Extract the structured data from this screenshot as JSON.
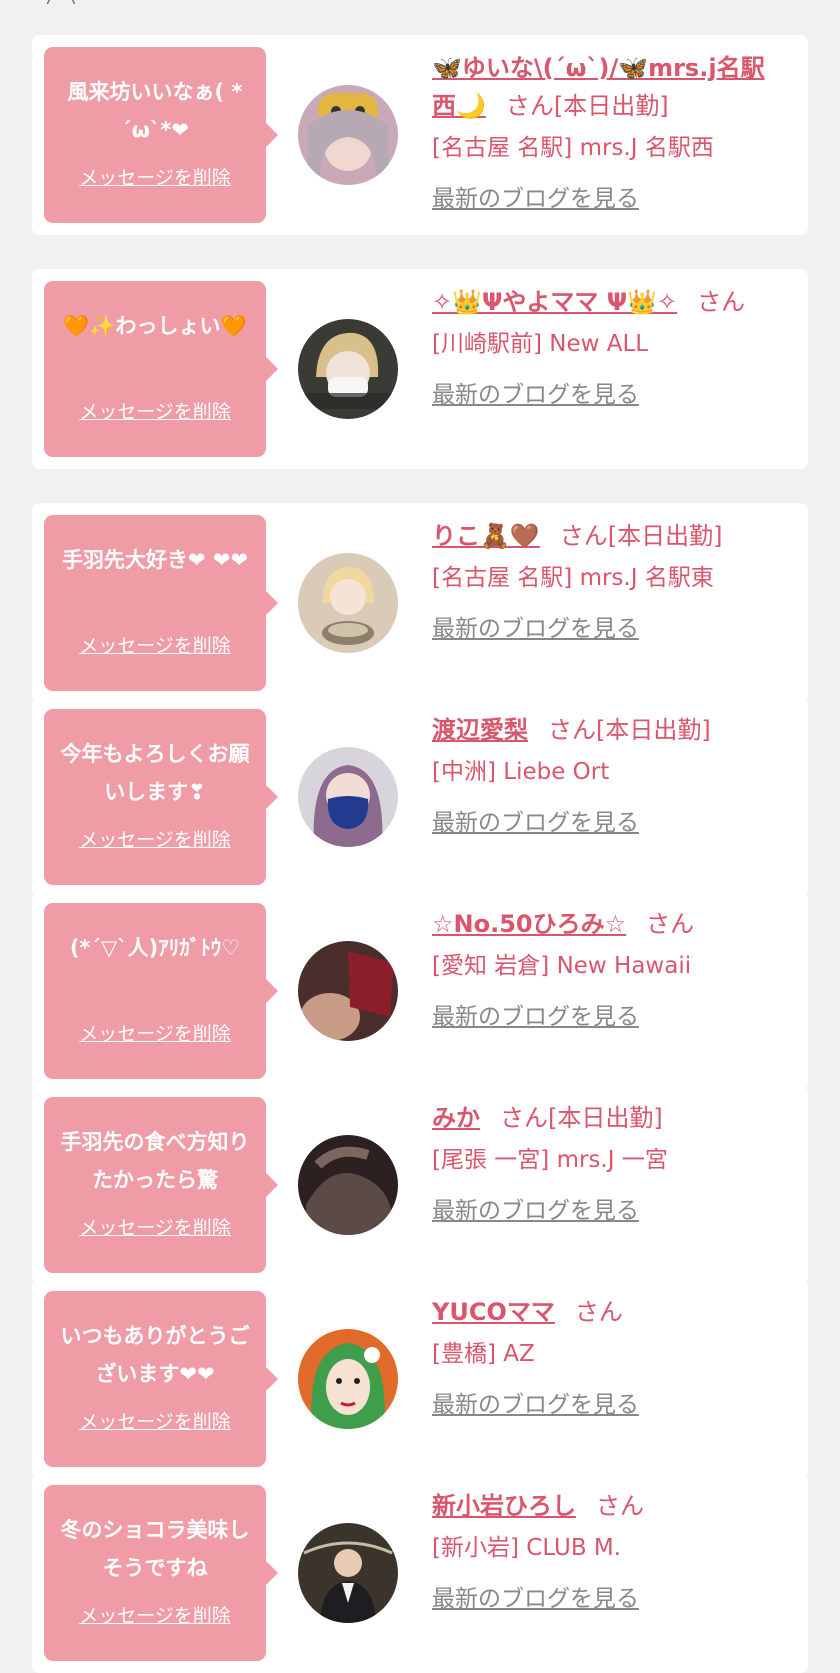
{
  "top_fragment": "（　）",
  "colors": {
    "background": "#f1f1f1",
    "bubble": "#ef9ca6",
    "accent": "#d9566c",
    "muted": "#888888"
  },
  "cards": [
    {
      "message": "風来坊いいなぁ( * ´ω`*❤",
      "delete_label": "メッセージを削除",
      "name": "🦋ゆいな\\(´ω`)/🦋mrs.j名駅西🌙",
      "honorific": "さん[本日出勤]",
      "shop": "[名古屋 名駅] mrs.J 名駅西",
      "blog_label": "最新のブログを見る",
      "avatar_icon": "profile-photo-tiger-filter"
    },
    {
      "message": "🧡✨わっしょい🧡",
      "delete_label": "メッセージを削除",
      "name": "✧👑Ψやよママ Ψ👑✧",
      "honorific": "さん",
      "shop": "[川崎駅前] New ALL",
      "blog_label": "最新のブログを見る",
      "avatar_icon": "profile-photo-mask"
    },
    {
      "message": "手羽先大好き❤ ❤❤",
      "delete_label": "メッセージを削除",
      "name": "りこ🧸🤎",
      "honorific": "さん[本日出勤]",
      "shop": "[名古屋 名駅] mrs.J 名駅東",
      "blog_label": "最新のブログを見る",
      "avatar_icon": "profile-photo-bowl"
    },
    {
      "message": "今年もよろしくお願いします❣",
      "delete_label": "メッセージを削除",
      "name": "渡辺愛梨",
      "honorific": "さん[本日出勤]",
      "shop": "[中洲] Liebe Ort",
      "blog_label": "最新のブログを見る",
      "avatar_icon": "profile-photo-blue-mask"
    },
    {
      "message": "(*´▽`人)ｱﾘｶﾞﾄｳ♡",
      "delete_label": "メッセージを削除",
      "name": "☆No.50ひろみ☆",
      "honorific": "さん",
      "shop": "[愛知 岩倉] New Hawaii",
      "blog_label": "最新のブログを見る",
      "avatar_icon": "profile-photo-love"
    },
    {
      "message": "手羽先の食べ方知りたかったら驚",
      "delete_label": "メッセージを削除",
      "name": "みか",
      "honorific": "さん[本日出勤]",
      "shop": "[尾張 一宮] mrs.J 一宮",
      "blog_label": "最新のブログを見る",
      "avatar_icon": "profile-photo-legs"
    },
    {
      "message": "いつもありがとうございます❤❤",
      "delete_label": "メッセージを削除",
      "name": "YUCOママ",
      "honorific": "さん",
      "shop": "[豊橋] AZ",
      "blog_label": "最新のブログを見る",
      "avatar_icon": "profile-illustration-green-hair"
    },
    {
      "message": "冬のショコラ美味しそうですね",
      "delete_label": "メッセージを削除",
      "name": "新小岩ひろし",
      "honorific": "さん",
      "shop": "[新小岩] CLUB M.",
      "blog_label": "最新のブログを見る",
      "avatar_icon": "profile-photo-man-suit"
    }
  ]
}
